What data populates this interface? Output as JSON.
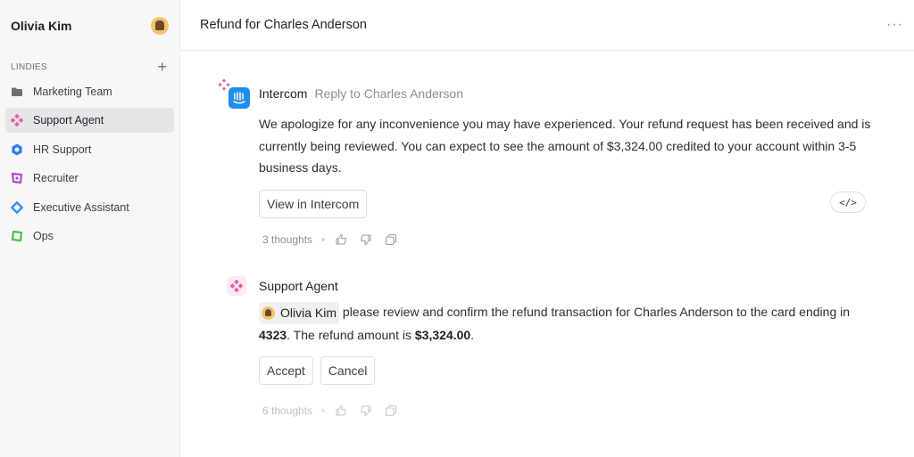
{
  "sidebar": {
    "user_name": "Olivia Kim",
    "section_label": "LINDIES",
    "add_label": "+",
    "items": [
      {
        "label": "Marketing Team",
        "icon": "folder-icon",
        "color": "#6b6f76"
      },
      {
        "label": "Support Agent",
        "icon": "support-agent-icon",
        "color": "#e85ea9"
      },
      {
        "label": "HR Support",
        "icon": "hr-support-icon",
        "color": "#2e7cf6"
      },
      {
        "label": "Recruiter",
        "icon": "recruiter-icon",
        "color": "#b04bd8"
      },
      {
        "label": "Executive Assistant",
        "icon": "executive-assistant-icon",
        "color": "#3a8ef0"
      },
      {
        "label": "Ops",
        "icon": "ops-icon",
        "color": "#4cc04a"
      }
    ],
    "active_item": "Support Agent"
  },
  "header": {
    "title": "Refund for Charles Anderson",
    "more_label": "···"
  },
  "messages": [
    {
      "sender": "Intercom",
      "reply_to": "Reply to Charles Anderson",
      "body": "We apologize for any inconvenience you may have experienced. Your refund request has been received and is currently being reviewed. You can expect to see the amount of $3,324.00 credited to your account within 3-5 business days.",
      "action_label": "View in Intercom",
      "code_label": "</>",
      "thoughts": "3 thoughts"
    },
    {
      "sender": "Support Agent",
      "mention": "Olivia Kim",
      "body_part1": " please review and confirm the refund transaction for Charles Anderson to the card ending in ",
      "card_digits": "4323",
      "body_part2": ". The refund amount is ",
      "amount": "$3,324.00",
      "body_part3": ".",
      "accept_label": "Accept",
      "cancel_label": "Cancel",
      "thoughts": "6 thoughts"
    }
  ],
  "meta": {
    "dot": "•"
  },
  "colors": {
    "accent_pink": "#e85ea9",
    "intercom_blue": "#1f8ded",
    "sidebar_bg": "#f7f7f8"
  }
}
